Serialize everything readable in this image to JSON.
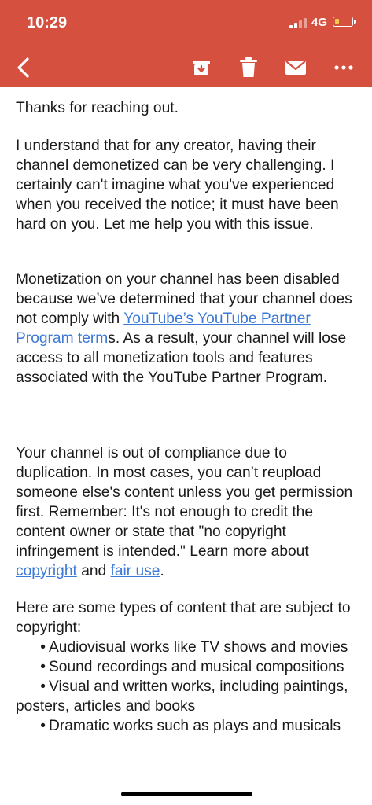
{
  "status_bar": {
    "time": "10:29",
    "network": "4G"
  },
  "toolbar": {
    "back_icon": "chevron-left-icon",
    "archive_icon": "archive-icon",
    "delete_icon": "trash-icon",
    "mail_icon": "envelope-icon",
    "more_icon": "more-horizontal-icon"
  },
  "colors": {
    "header": "#d6503f",
    "link": "#3b79d6",
    "text": "#1a1a1a"
  },
  "email": {
    "p1": "Thanks for reaching out.",
    "p2": "I understand that for any creator, having their channel demonetized can be very challenging. I certainly can't imagine what you've experienced when you received the notice; it must have been hard on you. Let me help you with this issue.",
    "p3_before": "Monetization on your channel has been disabled because we’ve determined that your channel does not comply with ",
    "p3_link": "YouTube’s YouTube Partner Program term",
    "p3_after": "s. As a result, your channel will lose access to all monetization tools and features associated with the YouTube Partner Program.",
    "p4_before": "Your channel is out of compliance due to duplication. In most cases, you can’t reupload someone else's content unless you get permission first. Remember: It's not enough to credit the content owner or state that \"no copyright infringement is intended.\" Learn more about ",
    "p4_link1": "copyright",
    "p4_and": " and ",
    "p4_link2": "fair use",
    "p4_end": ".",
    "p5_intro": "Here are some types of content that are subject to copyright:",
    "bullets": [
      "Audiovisual works like TV shows and movies",
      "Sound recordings and musical compositions",
      "Visual and written works, including paintings, posters, articles and books",
      "Dramatic works such as plays and musicals"
    ]
  }
}
